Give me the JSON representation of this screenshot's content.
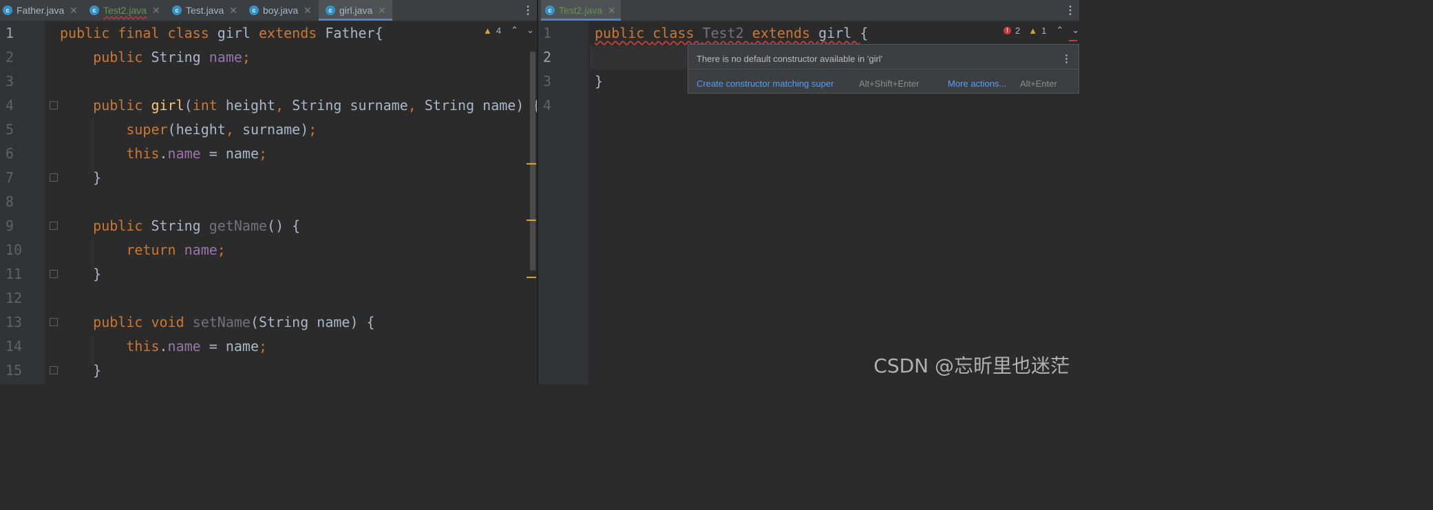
{
  "left_tabs": [
    {
      "label": "Father.java",
      "icon": "class-icon"
    },
    {
      "label": "Test2.java",
      "icon": "class-icon"
    },
    {
      "label": "Test.java",
      "icon": "run-class-icon"
    },
    {
      "label": "boy.java",
      "icon": "class-icon"
    },
    {
      "label": "girl.java",
      "icon": "class-icon"
    }
  ],
  "right_tabs": [
    {
      "label": "Test2.java",
      "icon": "class-icon"
    }
  ],
  "left_editor": {
    "inspection": {
      "warnings": "4"
    },
    "line_numbers": [
      "1",
      "2",
      "3",
      "4",
      "5",
      "6",
      "7",
      "8",
      "9",
      "10",
      "11",
      "12",
      "13",
      "14",
      "15"
    ],
    "lines": [
      [
        {
          "t": "public final class ",
          "c": "kw"
        },
        {
          "t": "girl ",
          "c": "p"
        },
        {
          "t": "extends ",
          "c": "kw"
        },
        {
          "t": "Father{",
          "c": "p"
        }
      ],
      [
        {
          "t": "    public ",
          "c": "kw"
        },
        {
          "t": "String ",
          "c": "p"
        },
        {
          "t": "name",
          "c": "fld"
        },
        {
          "t": ";",
          "c": "punct"
        }
      ],
      [],
      [
        {
          "t": "    public ",
          "c": "kw"
        },
        {
          "t": "girl",
          "c": "meth"
        },
        {
          "t": "(",
          "c": "p"
        },
        {
          "t": "int ",
          "c": "kw"
        },
        {
          "t": "height",
          "c": "p"
        },
        {
          "t": ", ",
          "c": "punct"
        },
        {
          "t": "String surname",
          "c": "p"
        },
        {
          "t": ", ",
          "c": "punct"
        },
        {
          "t": "String name) {",
          "c": "p"
        }
      ],
      [
        {
          "t": "        super",
          "c": "kw"
        },
        {
          "t": "(height",
          "c": "p"
        },
        {
          "t": ", ",
          "c": "punct"
        },
        {
          "t": "surname)",
          "c": "p"
        },
        {
          "t": ";",
          "c": "punct"
        }
      ],
      [
        {
          "t": "        this",
          "c": "kw"
        },
        {
          "t": ".",
          "c": "p"
        },
        {
          "t": "name ",
          "c": "fld"
        },
        {
          "t": "= name",
          "c": "p"
        },
        {
          "t": ";",
          "c": "punct"
        }
      ],
      [
        {
          "t": "    }",
          "c": "p"
        }
      ],
      [],
      [
        {
          "t": "    public ",
          "c": "kw"
        },
        {
          "t": "String ",
          "c": "p"
        },
        {
          "t": "getName",
          "c": "unused"
        },
        {
          "t": "() {",
          "c": "p"
        }
      ],
      [
        {
          "t": "        return ",
          "c": "kw"
        },
        {
          "t": "name",
          "c": "fld"
        },
        {
          "t": ";",
          "c": "punct"
        }
      ],
      [
        {
          "t": "    }",
          "c": "p"
        }
      ],
      [],
      [
        {
          "t": "    public ",
          "c": "kw"
        },
        {
          "t": "void ",
          "c": "kw"
        },
        {
          "t": "setName",
          "c": "unused"
        },
        {
          "t": "(String name) {",
          "c": "p"
        }
      ],
      [
        {
          "t": "        this",
          "c": "kw"
        },
        {
          "t": ".",
          "c": "p"
        },
        {
          "t": "name ",
          "c": "fld"
        },
        {
          "t": "= name",
          "c": "p"
        },
        {
          "t": ";",
          "c": "punct"
        }
      ],
      [
        {
          "t": "    }",
          "c": "p"
        }
      ]
    ]
  },
  "right_editor": {
    "inspection": {
      "errors": "2",
      "warnings": "1"
    },
    "line_numbers": [
      "1",
      "2",
      "3",
      "4"
    ],
    "lines": [
      [
        {
          "t": "public ",
          "c": "kw sq"
        },
        {
          "t": "class ",
          "c": "kw sq"
        },
        {
          "t": "Test2 ",
          "c": "unused sq"
        },
        {
          "t": "extends ",
          "c": "kw sq"
        },
        {
          "t": "girl ",
          "c": "p sq"
        },
        {
          "t": "{",
          "c": "p"
        }
      ],
      [],
      [
        {
          "t": "}",
          "c": "p"
        }
      ],
      []
    ]
  },
  "tooltip": {
    "message": "There is no default constructor available in 'girl'",
    "action": "Create constructor matching super",
    "action_shortcut": "Alt+Shift+Enter",
    "more": "More actions...",
    "more_shortcut": "Alt+Enter"
  },
  "watermark": "CSDN @忘昕里也迷茫",
  "colors": {
    "keyword": "#cc7832",
    "field": "#9876aa",
    "method": "#ffc66d",
    "text": "#a9b7c6",
    "unused": "#72737a"
  }
}
